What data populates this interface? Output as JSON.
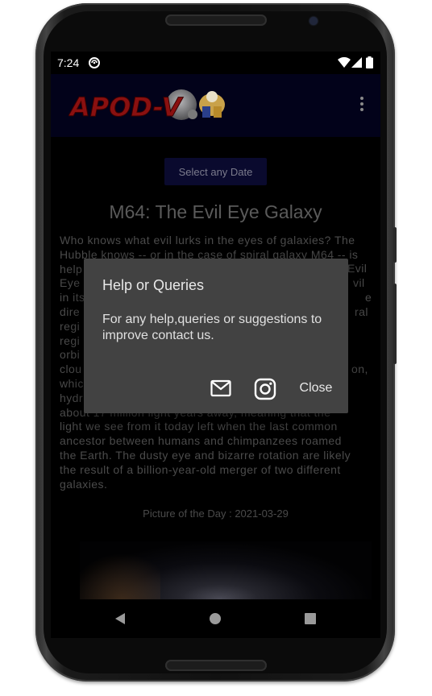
{
  "status_bar": {
    "time": "7:24"
  },
  "app_bar": {
    "logo_text": "APOD-V",
    "overflow_icon": "more-vert-icon"
  },
  "main": {
    "date_button_label": "Select any Date",
    "title": "M64: The Evil Eye Galaxy",
    "description_lines": [
      "Who knows what evil lurks in the eyes of galaxies? The",
      "Hubble knows -- or in the case of spiral galaxy M64 -- is",
      "help",
      "Eye",
      "in its",
      "dire",
      "regi",
      "regi",
      "orbi",
      "clou",
      "which",
      "hydr",
      "about 17 million light years away, meaning that the",
      "light we see from it today left when the last common",
      "ancestor between humans and chimpanzees roamed",
      "the Earth.  The dusty eye and bizarre rotation are likely",
      "the result of a billion-year-old merger of two different",
      "galaxies."
    ],
    "description_right_fragments": [
      "Evil",
      "vil",
      "e",
      "ral",
      "on,"
    ],
    "picture_date_label": "Picture of the Day : 2021-03-29"
  },
  "dialog": {
    "title": "Help or Queries",
    "body": "For any help,queries or suggestions to improve contact us.",
    "mail_icon": "mail-icon",
    "instagram_icon": "instagram-icon",
    "close_label": "Close"
  },
  "nav_bar": {
    "back_icon": "back-icon",
    "home_icon": "home-icon",
    "recents_icon": "recents-icon"
  },
  "colors": {
    "app_bar_bg": "#02021a",
    "dialog_bg": "#424242",
    "screen_bg": "#000000"
  }
}
